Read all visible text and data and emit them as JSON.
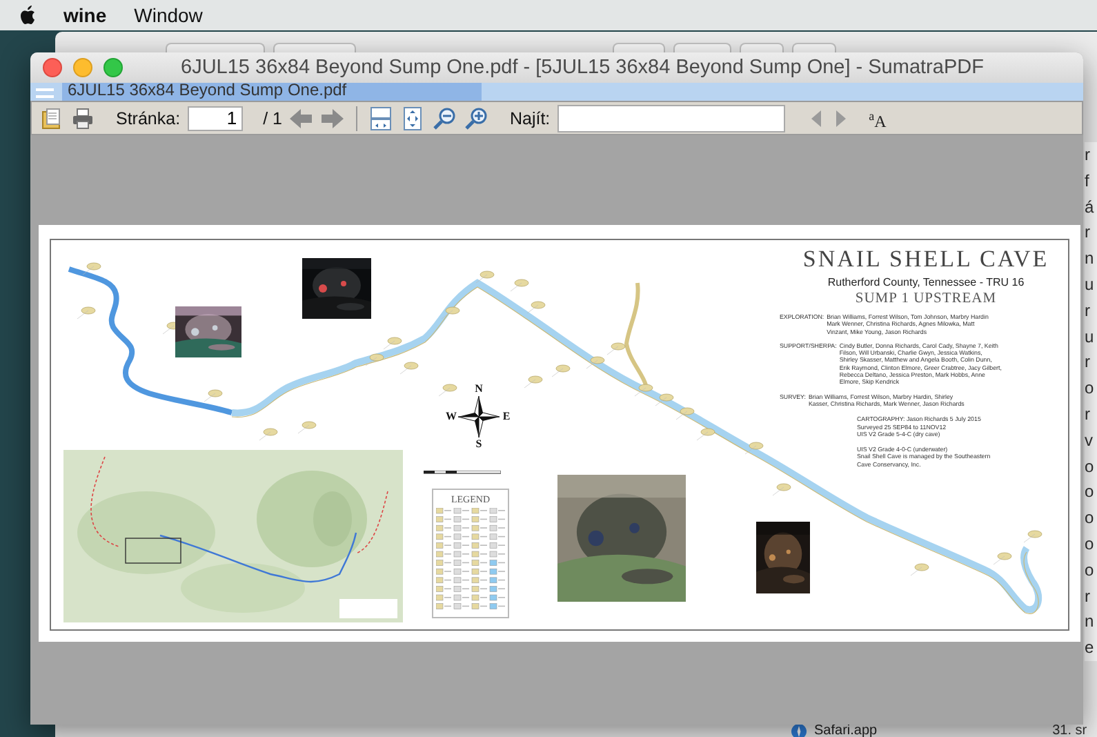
{
  "menubar": {
    "items": [
      "wine",
      "Window"
    ]
  },
  "background_window": {
    "list_items": [
      "r",
      "f",
      "á",
      "r",
      "n",
      "u",
      "r",
      "u",
      "r",
      "o",
      "r",
      "v",
      "o",
      "o",
      "o",
      "o",
      "o",
      "r",
      "n",
      "e"
    ],
    "bottom_items": [
      "Safari.app",
      "31. sr"
    ]
  },
  "window": {
    "title": "6JUL15 36x84 Beyond Sump One.pdf - [5JUL15 36x84 Beyond Sump One] - SumatraPDF",
    "tabs": [
      {
        "label": "6JUL15 36x84 Beyond Sump One.pdf",
        "selected": true
      }
    ],
    "toolbar": {
      "page_label": "Stránka:",
      "page_value": "1",
      "page_total": "/ 1",
      "find_label": "Najít:",
      "match_case": "$^{a}$A"
    },
    "page": {
      "title": "SNAIL SHELL CAVE",
      "subtitle": "Rutherford County, Tennessee - TRU 16",
      "heading": "SUMP 1 UPSTREAM",
      "credits": [
        {
          "label": "EXPLORATION:",
          "names": "Brian Williams, Forrest Wilson, Tom Johnson, Marbry Hardin Mark Wenner, Christina Richards, Agnes Milowka, Matt Vinzant, Mike Young, Jason Richards"
        },
        {
          "label": "SUPPORT/SHERPA:",
          "names": "Cindy Butler, Donna Richards, Carol Cady, Shayne 7, Keith Filson, Will Urbanski, Charlie Gwyn, Jessica Watkins, Shirley Skasser, Matthew and Angela Booth, Colin Dunn, Erik Raymond, Clinton Elmore, Greer Crabtree, Jacy Gilbert, Rebecca Deltano, Jessica Preston, Mark Hobbs, Anne Elmore, Skip Kendrick"
        },
        {
          "label": "SURVEY:",
          "names": "Brian Williams, Forrest Wilson, Marbry Hardin, Shirley Kasser, Christina Richards, Mark Wenner, Jason Richards"
        }
      ],
      "notes": [
        "CARTOGRAPHY: Jason Richards  5 July 2015",
        "Surveyed 25 SEP84 to 11NOV12",
        "UIS V2 Grade 5-4-C  (dry cave)",
        "UIS V2 Grade 4-0-C  (underwater)",
        "Snail Shell Cave is managed by the Southeastern Cave Conservancy, Inc."
      ],
      "compass": {
        "north": "N",
        "east": "E",
        "south": "S",
        "west": "W"
      },
      "legend_title": "LEGEND"
    }
  }
}
